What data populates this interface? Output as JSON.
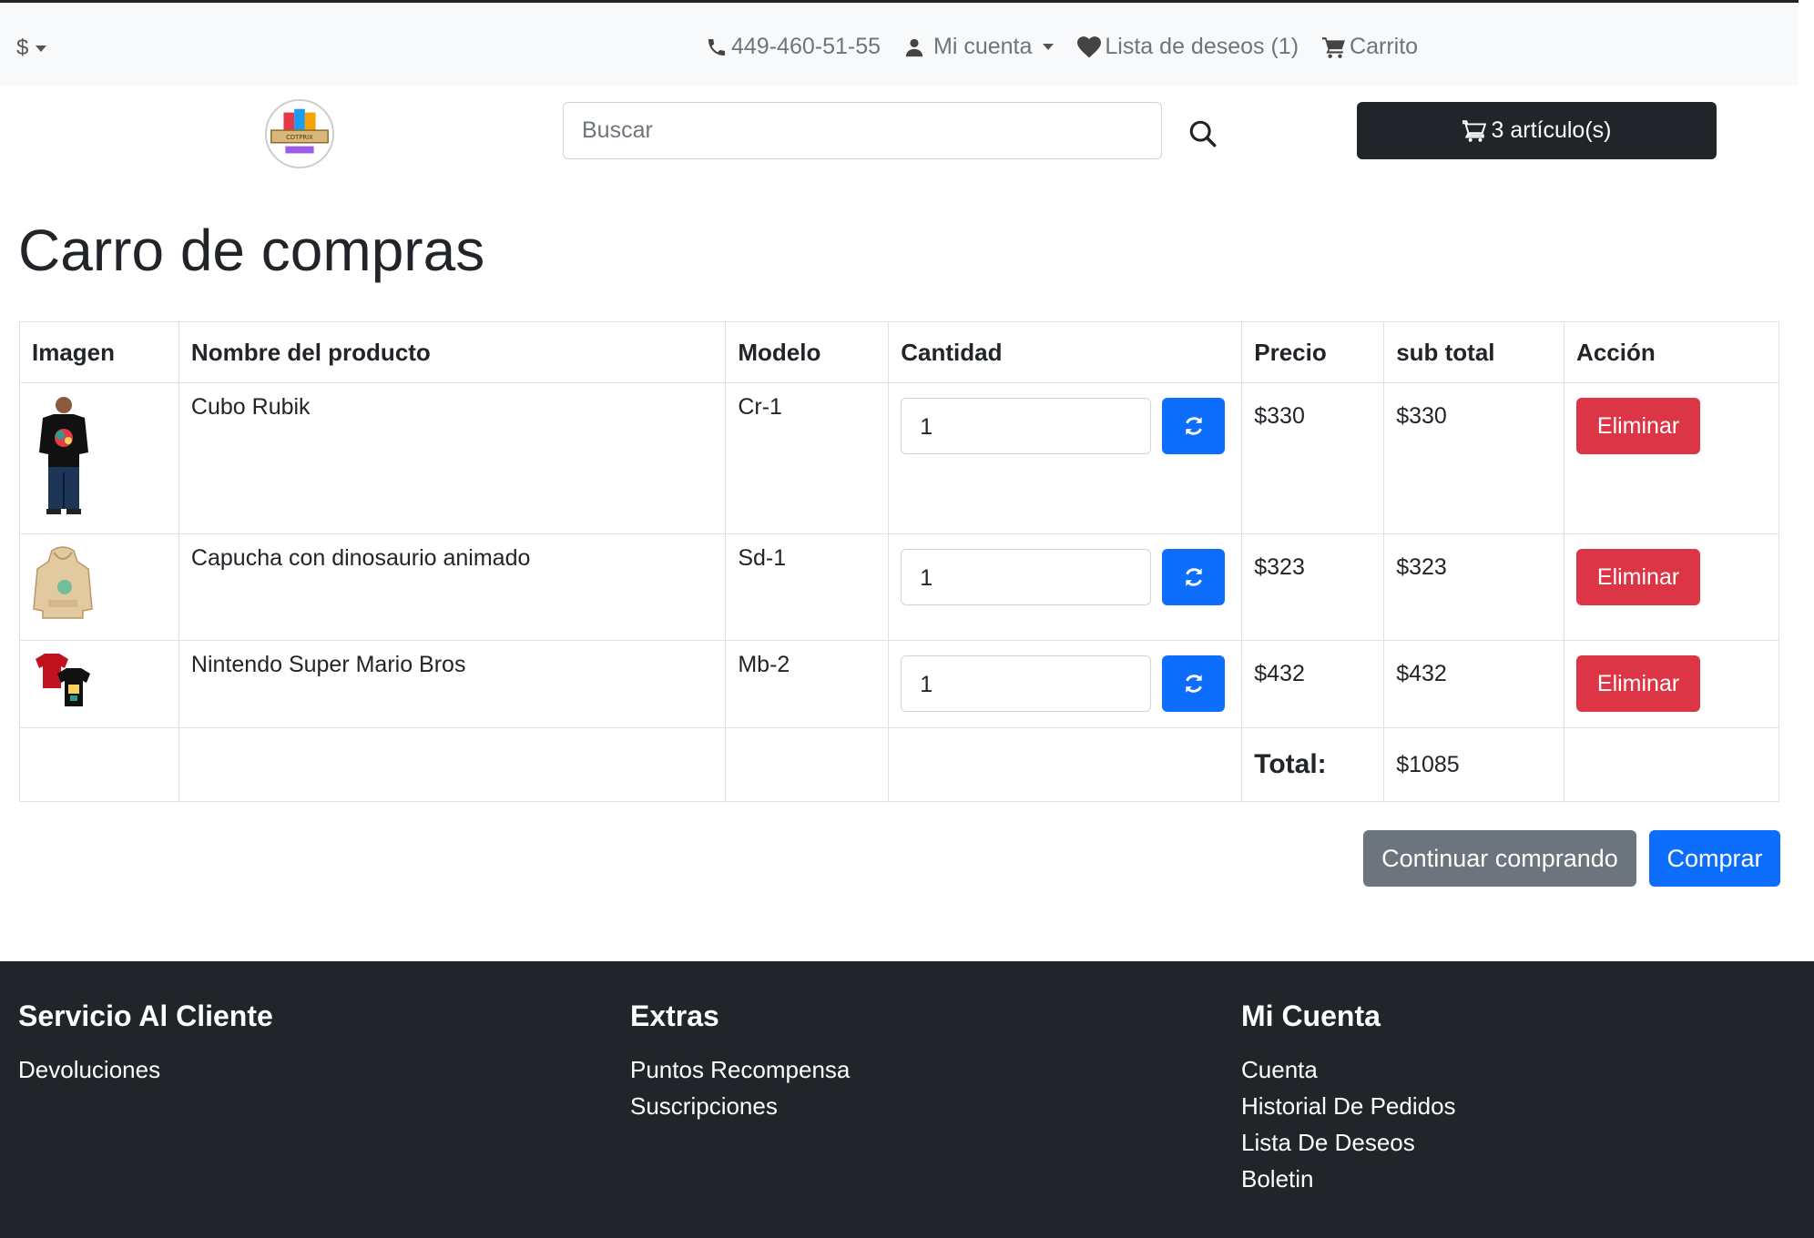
{
  "topbar": {
    "currency": "$",
    "phone": "449-460-51-55",
    "account": "Mi cuenta",
    "wishlist": "Lista de deseos (1)",
    "cart": "Carrito"
  },
  "header": {
    "logo_text": "CDTPRIX",
    "search_placeholder": "Buscar",
    "cart_button": "3 artículo(s)"
  },
  "page": {
    "title": "Carro de compras"
  },
  "table": {
    "headers": [
      "Imagen",
      "Nombre del producto",
      "Modelo",
      "Cantidad",
      "Precio",
      "sub total",
      "Acción"
    ],
    "rows": [
      {
        "name": "Cubo Rubik",
        "model": "Cr-1",
        "qty": "1",
        "price": "$330",
        "subtotal": "$330",
        "action": "Eliminar"
      },
      {
        "name": "Capucha con dinosaurio animado",
        "model": "Sd-1",
        "qty": "1",
        "price": "$323",
        "subtotal": "$323",
        "action": "Eliminar"
      },
      {
        "name": "Nintendo Super Mario Bros",
        "model": "Mb-2",
        "qty": "1",
        "price": "$432",
        "subtotal": "$432",
        "action": "Eliminar"
      }
    ],
    "total_label": "Total:",
    "total_value": "$1085"
  },
  "actions": {
    "continue": "Continuar comprando",
    "buy": "Comprar"
  },
  "footer": {
    "customer_service": {
      "title": "Servicio Al Cliente",
      "links": [
        "Devoluciones"
      ]
    },
    "extras": {
      "title": "Extras",
      "links": [
        "Puntos Recompensa",
        "Suscripciones"
      ]
    },
    "my_account": {
      "title": "Mi Cuenta",
      "links": [
        "Cuenta",
        "Historial De Pedidos",
        "Lista De Deseos",
        "Boletin"
      ]
    }
  },
  "colors": {
    "primary": "#0d6efd",
    "danger": "#dc3545",
    "secondary": "#6c757d",
    "dark": "#212529"
  }
}
